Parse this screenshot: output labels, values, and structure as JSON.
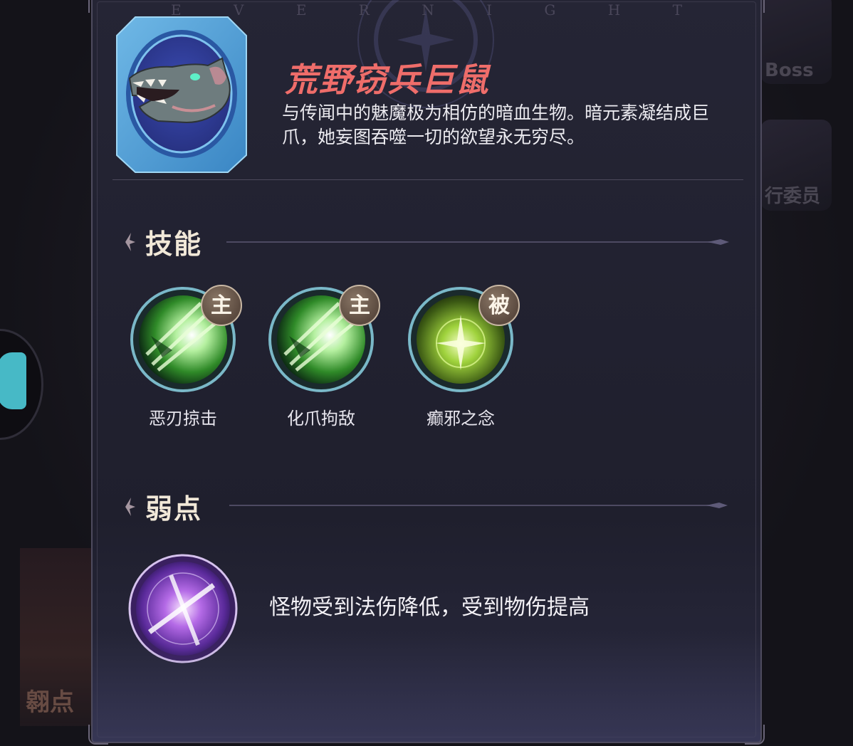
{
  "watermark": [
    "E",
    "V",
    "E",
    "R",
    "N",
    "I",
    "G",
    "H",
    "T"
  ],
  "monster": {
    "name": "荒野窃兵巨鼠",
    "description": "与传闻中的魅魔极为相仿的暗血生物。暗元素凝结成巨爪，她妄图吞噬一切的欲望永无穷尽。",
    "portrait_icon": "rat-head-icon"
  },
  "skills_section": {
    "title": "技能"
  },
  "skills": [
    {
      "name": "恶刃掠击",
      "type": "主",
      "icon": "green-claw-slash-icon"
    },
    {
      "name": "化爪拘敌",
      "type": "主",
      "icon": "green-claw-slash-icon"
    },
    {
      "name": "癫邪之念",
      "type": "被",
      "icon": "green-burst-icon"
    }
  ],
  "weakness_section": {
    "title": "弱点"
  },
  "weakness": {
    "text": "怪物受到法伤降低，受到物伤提高",
    "icon": "purple-slash-orb-icon"
  },
  "background": {
    "right_cards": [
      "Boss",
      "行委员"
    ],
    "bottom_left": "翱点"
  },
  "colors": {
    "name": "#ef6d6a",
    "panel": "#252535",
    "badge": "#5b4a3f",
    "section_title": "#f1e8d8"
  }
}
